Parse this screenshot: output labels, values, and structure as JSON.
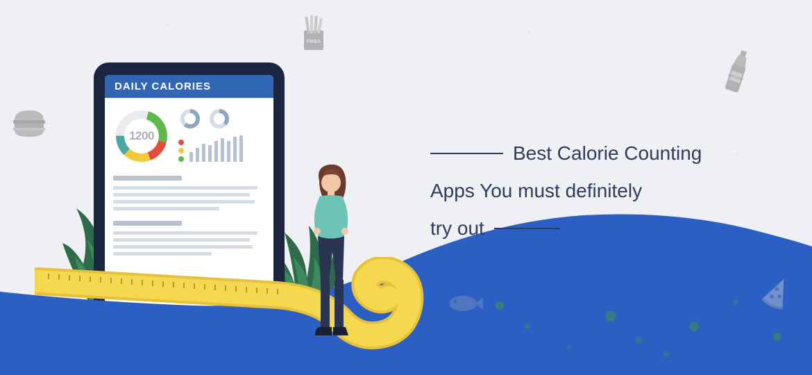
{
  "tablet": {
    "header": "DAILY CALORIES",
    "donut_value": "1200"
  },
  "headline": {
    "line1": "Best Calorie Counting",
    "line2": "Apps You must definitely",
    "line3": "try out"
  },
  "colors": {
    "header_blue": "#3166b5",
    "wave_blue": "#2b5fc4",
    "text_dark": "#2d3c5a",
    "donut_green": "#5fb94a",
    "donut_red": "#e34c3c",
    "donut_yellow": "#f4c93a",
    "donut_teal": "#4aa8a0"
  },
  "icons": {
    "fries": "fries-icon",
    "burger": "burger-icon",
    "ketchup": "ketchup-icon",
    "pizza": "pizza-icon",
    "fish": "fish-icon"
  }
}
